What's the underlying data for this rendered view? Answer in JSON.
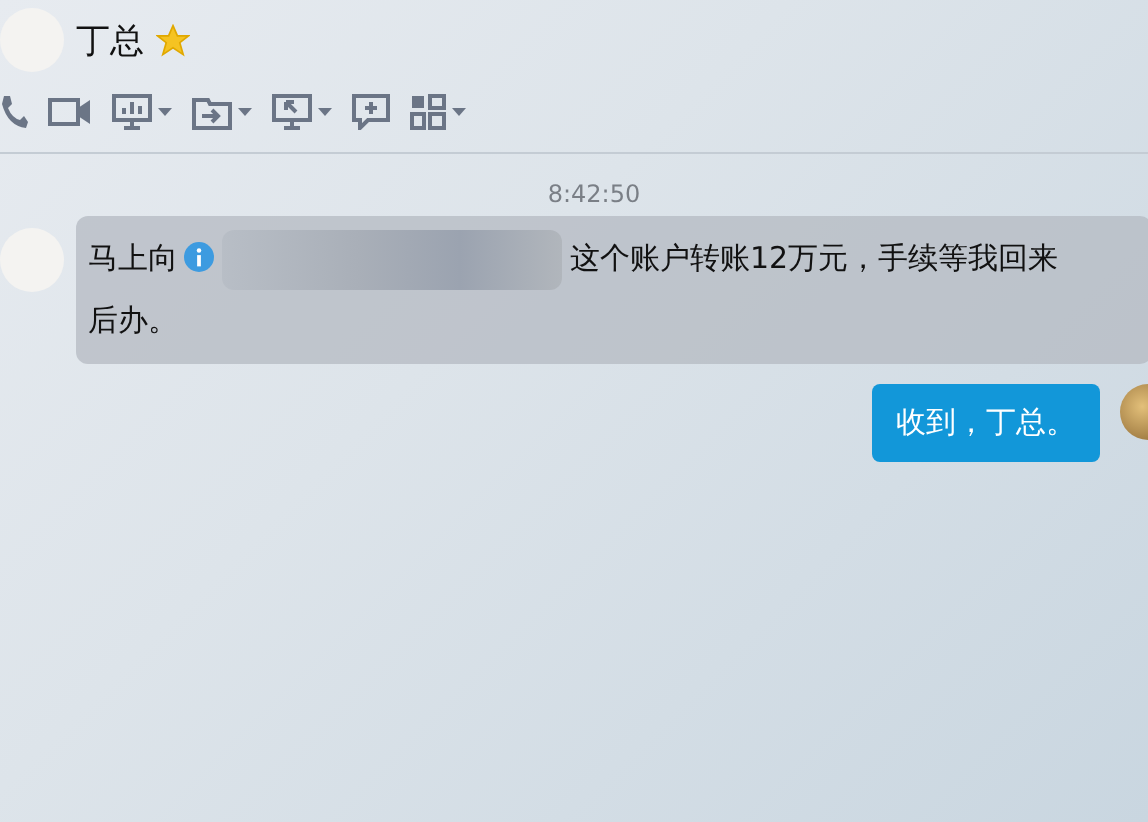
{
  "contact": {
    "name": "丁总",
    "starred": true
  },
  "toolbar": [
    {
      "kind": "phone",
      "menu": false
    },
    {
      "kind": "video",
      "menu": false
    },
    {
      "kind": "present",
      "menu": true
    },
    {
      "kind": "file",
      "menu": true
    },
    {
      "kind": "screen",
      "menu": true
    },
    {
      "kind": "add",
      "menu": false
    },
    {
      "kind": "apps",
      "menu": true
    }
  ],
  "timestamp": "8:42:50",
  "messages": [
    {
      "kind": "incoming",
      "text_before": "马上向",
      "redacted": true,
      "text_after": "这个账户转账12万元，手续等我回来",
      "text_continued": "后办。"
    },
    {
      "kind": "outgoing",
      "text": "收到，丁总。"
    }
  ]
}
